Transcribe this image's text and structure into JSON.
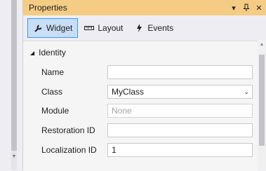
{
  "panel": {
    "title": "Properties",
    "title_icons": [
      "dropdown-arrow-icon",
      "pin-icon",
      "close-icon"
    ]
  },
  "tabs": [
    {
      "label": "Widget",
      "icon": "wrench-icon",
      "active": true
    },
    {
      "label": "Layout",
      "icon": "ruler-icon",
      "active": false
    },
    {
      "label": "Events",
      "icon": "lightning-icon",
      "active": false
    }
  ],
  "section": {
    "title": "Identity"
  },
  "fields": [
    {
      "label": "Name",
      "value": "",
      "placeholder": ""
    },
    {
      "label": "Class",
      "value": "MyClass",
      "placeholder": ""
    },
    {
      "label": "Module",
      "value": "",
      "placeholder": "None"
    },
    {
      "label": "Restoration ID",
      "value": "",
      "placeholder": ""
    },
    {
      "label": "Localization ID",
      "value": "1",
      "placeholder": ""
    }
  ],
  "colors": {
    "title_bar": "#f5cc84",
    "active_tab_bg": "#c9def5",
    "active_tab_border": "#3399ff"
  }
}
